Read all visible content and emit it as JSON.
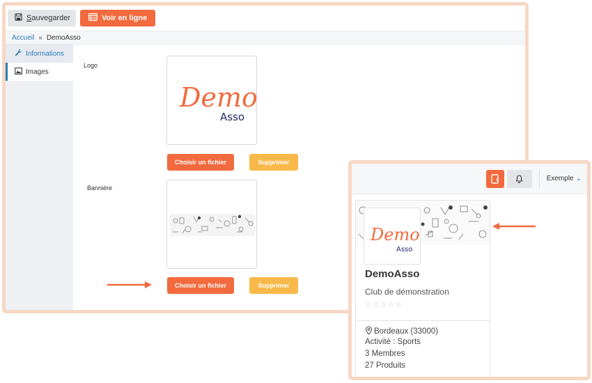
{
  "toolbar": {
    "save_label": "Sauvegarder",
    "view_online_label": "Voir en ligne"
  },
  "breadcrumb": {
    "home": "Accueil",
    "separator": "»",
    "current": "DemoAsso"
  },
  "sidebar": {
    "items": [
      {
        "label": "Informations",
        "icon": "wrench-icon"
      },
      {
        "label": "Images",
        "icon": "image-icon"
      }
    ]
  },
  "form": {
    "logo_label": "Logo",
    "banner_label": "Bannière",
    "choose_file_label": "Choisir un fichier",
    "delete_label": "Supprimer"
  },
  "logo": {
    "word1": "Demo",
    "word2": "Asso"
  },
  "preview": {
    "user_label": "Exemple",
    "card": {
      "name": "DemoAsso",
      "description": "Club de démonstration",
      "stars": "☆☆☆☆☆",
      "location": "Bordeaux (33000)",
      "activity": "Activité : Sports",
      "members": "3 Membres",
      "products": "27 Produits"
    }
  },
  "colors": {
    "accent": "#f26a3d",
    "warning": "#f8b84a",
    "link": "#2b7bb9",
    "panel_border": "#f7d8c4",
    "logo_navy": "#1f2a6b"
  }
}
